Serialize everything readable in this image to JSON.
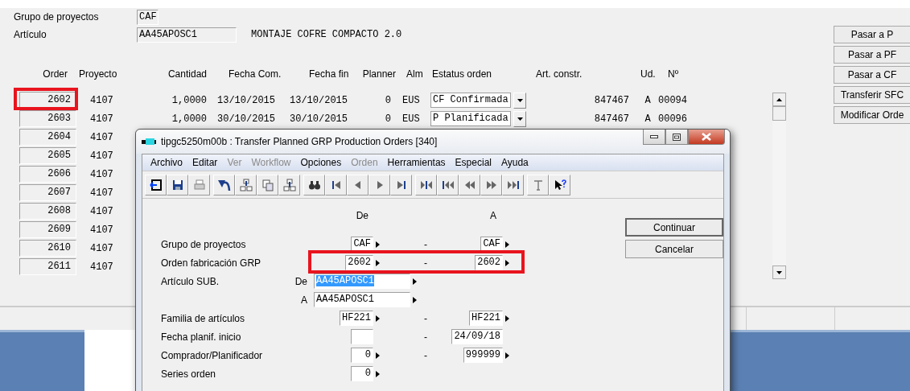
{
  "main": {
    "fields": [
      {
        "label": "Grupo de proyectos",
        "value": "CAF"
      },
      {
        "label": "Artículo",
        "value": "AA45APOSC1",
        "description": "MONTAJE COFRE COMPACTO 2.0"
      }
    ],
    "table": {
      "columns": [
        "Order",
        "Proyecto",
        "Cantidad",
        "Fecha Com.",
        "Fecha fin",
        "Planner",
        "Alm",
        "Estatus orden",
        "Art. constr.",
        "Ud.",
        "Nº"
      ],
      "rows": [
        {
          "order": "2602",
          "proyecto": "4107",
          "cantidad": "1,0000",
          "fecha_com": "13/10/2015",
          "fecha_fin": "13/10/2015",
          "planner": "0",
          "alm": "EUS",
          "estatus": "CF Confirmada",
          "art_constr": "847467",
          "ud": "A",
          "num": "00094",
          "highlighted": true
        },
        {
          "order": "2603",
          "proyecto": "4107",
          "cantidad": "1,0000",
          "fecha_com": "30/10/2015",
          "fecha_fin": "30/10/2015",
          "planner": "0",
          "alm": "EUS",
          "estatus": "P  Planificada",
          "art_constr": "847467",
          "ud": "A",
          "num": "00096",
          "highlighted": false
        },
        {
          "order": "2604",
          "proyecto": "4107",
          "highlighted": false
        },
        {
          "order": "2605",
          "proyecto": "4107",
          "highlighted": false
        },
        {
          "order": "2606",
          "proyecto": "4107",
          "highlighted": false
        },
        {
          "order": "2607",
          "proyecto": "4107",
          "highlighted": false
        },
        {
          "order": "2608",
          "proyecto": "4107",
          "highlighted": false
        },
        {
          "order": "2609",
          "proyecto": "4107",
          "highlighted": false
        },
        {
          "order": "2610",
          "proyecto": "4107",
          "highlighted": false
        },
        {
          "order": "2611",
          "proyecto": "4107",
          "highlighted": false
        }
      ]
    },
    "buttons": [
      "Pasar a P",
      "Pasar a PF",
      "Pasar a CF",
      "Transferir SFC",
      "Modificar Orde"
    ]
  },
  "dialog": {
    "title": "tipgc5250m00b : Transfer Planned GRP Production Orders [340]",
    "menu": [
      {
        "label": "Archivo",
        "disabled": false
      },
      {
        "label": "Editar",
        "disabled": false
      },
      {
        "label": "Ver",
        "disabled": true
      },
      {
        "label": "Workflow",
        "disabled": true
      },
      {
        "label": "Opciones",
        "disabled": false
      },
      {
        "label": "Orden",
        "disabled": true
      },
      {
        "label": "Herramientas",
        "disabled": false
      },
      {
        "label": "Especial",
        "disabled": false
      },
      {
        "label": "Ayuda",
        "disabled": false
      }
    ],
    "header_from": "De",
    "header_to": "A",
    "rows": [
      {
        "kind": "range",
        "label": "Grupo de proyectos",
        "from": {
          "value": "CAF",
          "lookup": true
        },
        "to": {
          "value": "CAF",
          "lookup": true
        },
        "dash": "-",
        "highlighted": false
      },
      {
        "kind": "range",
        "label": "Orden fabricación GRP",
        "from": {
          "value": "2602",
          "lookup": true
        },
        "to": {
          "value": "2602",
          "lookup": true
        },
        "dash": "-",
        "highlighted": true
      },
      {
        "kind": "stacked",
        "label": "Artículo SUB.",
        "from_label": "De",
        "from": {
          "value": "AA45APOSC1",
          "lookup": true,
          "selected": true
        },
        "to_label": "A",
        "to": {
          "value": "AA45APOSC1",
          "lookup": true,
          "selected": false
        }
      },
      {
        "kind": "range",
        "label": "Familia de artículos",
        "from": {
          "value": "HF221",
          "lookup": true
        },
        "to": {
          "value": "HF221",
          "lookup": true
        },
        "dash": "-",
        "highlighted": false
      },
      {
        "kind": "range",
        "label": "Fecha planif. inicio",
        "from": {
          "lookup": false
        },
        "to": {
          "value": "24/09/18",
          "lookup": false
        },
        "dash": "-",
        "highlighted": false
      },
      {
        "kind": "range",
        "label": "Comprador/Planificador",
        "from": {
          "value": "0",
          "lookup": true
        },
        "to": {
          "value": "999999",
          "lookup": true
        },
        "dash": "-",
        "highlighted": false
      },
      {
        "kind": "single",
        "label": "Series orden",
        "from": {
          "value": "0",
          "lookup": true
        }
      }
    ],
    "buttons": [
      {
        "label": "Continuar",
        "default": true
      },
      {
        "label": "Cancelar",
        "default": false
      }
    ]
  }
}
